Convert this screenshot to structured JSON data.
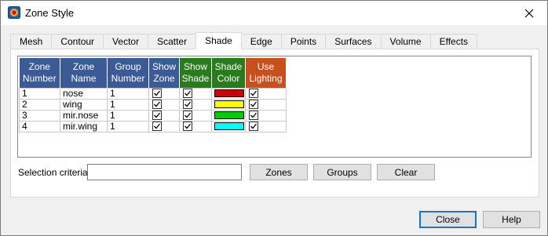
{
  "window": {
    "title": "Zone Style"
  },
  "tabs": [
    {
      "label": "Mesh"
    },
    {
      "label": "Contour"
    },
    {
      "label": "Vector"
    },
    {
      "label": "Scatter"
    },
    {
      "label": "Shade"
    },
    {
      "label": "Edge"
    },
    {
      "label": "Points"
    },
    {
      "label": "Surfaces"
    },
    {
      "label": "Volume"
    },
    {
      "label": "Effects"
    }
  ],
  "active_tab": "Shade",
  "grid": {
    "headers": {
      "zone_number": [
        "Zone",
        "Number"
      ],
      "zone_name": [
        "Zone",
        "Name"
      ],
      "group_number": [
        "Group",
        "Number"
      ],
      "show_zone": [
        "Show",
        "Zone"
      ],
      "show_shade": [
        "Show",
        "Shade"
      ],
      "shade_color": [
        "Shade",
        "Color"
      ],
      "use_lighting": [
        "Use",
        "Lighting"
      ]
    },
    "header_colors": {
      "blue": "#3c5a96",
      "green": "#2a7a1e",
      "orange": "#c8501e"
    },
    "rows": [
      {
        "number": "1",
        "name": "nose",
        "group": "1",
        "show_zone": true,
        "show_shade": true,
        "color": "#cc0000",
        "lighting": true
      },
      {
        "number": "2",
        "name": "wing",
        "group": "1",
        "show_zone": true,
        "show_shade": true,
        "color": "#ffff00",
        "lighting": true
      },
      {
        "number": "3",
        "name": "mir.nose",
        "group": "1",
        "show_zone": true,
        "show_shade": true,
        "color": "#00cc00",
        "lighting": true
      },
      {
        "number": "4",
        "name": "mir.wing",
        "group": "1",
        "show_zone": true,
        "show_shade": true,
        "color": "#00ffff",
        "lighting": true
      }
    ]
  },
  "selection": {
    "label": "Selection criteria:",
    "value": "",
    "zones_button": "Zones",
    "groups_button": "Groups",
    "clear_button": "Clear"
  },
  "footer": {
    "close_button": "Close",
    "help_button": "Help"
  }
}
